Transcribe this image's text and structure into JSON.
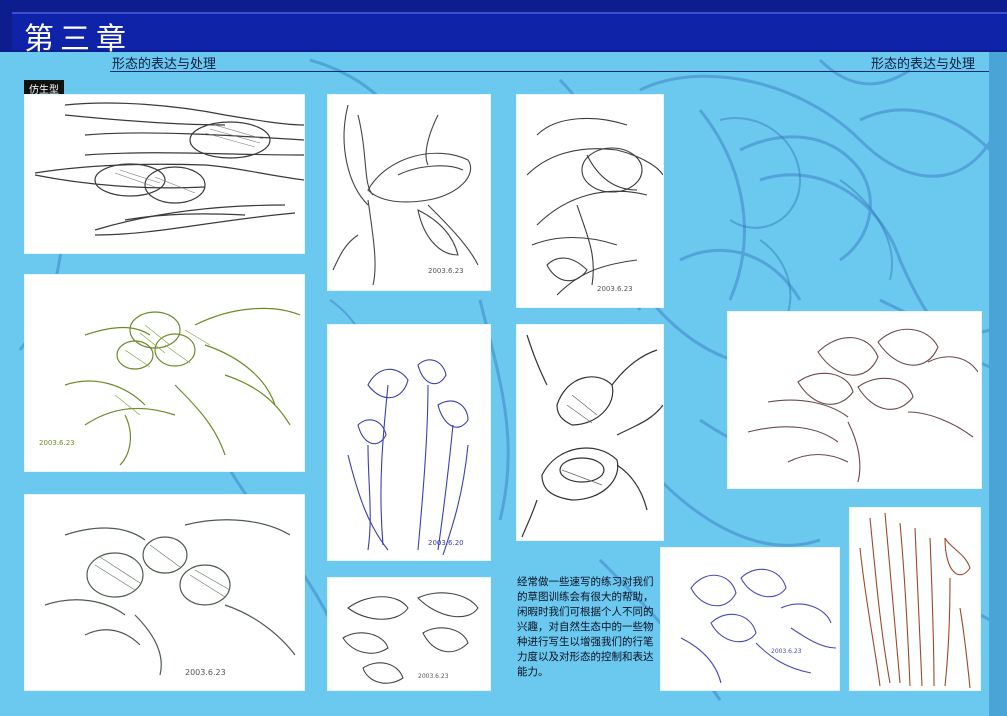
{
  "header": {
    "chapter": "第三章",
    "subtitle_left": "形态的表达与处理",
    "subtitle_right": "形态的表达与处理"
  },
  "section_tag": "仿生型",
  "caption": "经常做一些速写的练习对我们的草图训练会有很大的帮助，闲暇时我们可根据个人不同的兴趣，对自然生态中的一些物种进行写生以增强我们的行笔力度以及对形态的控制和表达能力。",
  "sketches": [
    {
      "name": "pods",
      "color": "#3a3a3a",
      "signature": ""
    },
    {
      "name": "magnolia-bud",
      "color": "#444444",
      "signature": "2003.6.23"
    },
    {
      "name": "tulip-leaves",
      "color": "#3c3c3c",
      "signature": "2003.6.23"
    },
    {
      "name": "green-leaves",
      "color": "#6f8a2a",
      "signature": "2003.6.23"
    },
    {
      "name": "blue-iris",
      "color": "#3a3fb0",
      "signature": "2003.6.20"
    },
    {
      "name": "open-bud",
      "color": "#333333",
      "signature": ""
    },
    {
      "name": "magnolia-flower",
      "color": "#6a4a4a",
      "signature": ""
    },
    {
      "name": "grey-flowers",
      "color": "#4d5a4d",
      "signature": "2003.6.23"
    },
    {
      "name": "petals",
      "color": "#444444",
      "signature": "2003.6.23"
    },
    {
      "name": "blue-flowers",
      "color": "#4a4ab8",
      "signature": "2003.6.23"
    },
    {
      "name": "brown-iris",
      "color": "#9a4a2a",
      "signature": ""
    }
  ]
}
